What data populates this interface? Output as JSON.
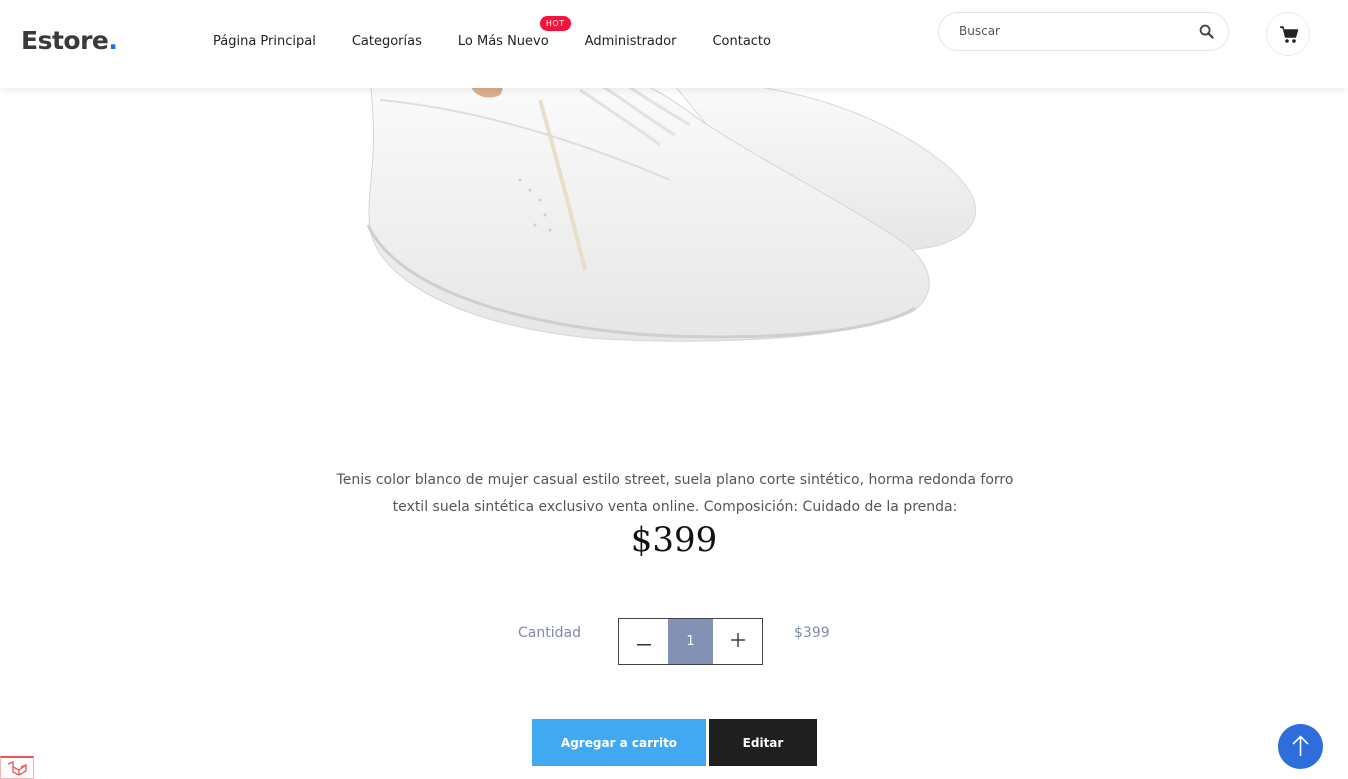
{
  "header": {
    "logo_text": "Estore",
    "logo_dot": ".",
    "nav": [
      {
        "label": "Página Principal"
      },
      {
        "label": "Categorías"
      },
      {
        "label": "Lo Más Nuevo",
        "badge": "HOT"
      },
      {
        "label": "Administrador"
      },
      {
        "label": "Contacto"
      }
    ],
    "search_placeholder": "Buscar"
  },
  "product": {
    "description": "Tenis color blanco de mujer casual estilo street, suela plano corte sintético, horma redonda forro textil suela sintética exclusivo venta online. Composición: Cuidado de la prenda:",
    "price": "$399",
    "quantity_label": "Cantidad",
    "quantity": "1",
    "line_total": "$399"
  },
  "actions": {
    "add_to_cart": "Agregar a carrito",
    "edit": "Editar"
  },
  "colors": {
    "accent_blue": "#40a9f2",
    "hot_badge": "#f5123b",
    "qty_bg": "#8391b4",
    "scroll_top": "#2e6ddc"
  }
}
